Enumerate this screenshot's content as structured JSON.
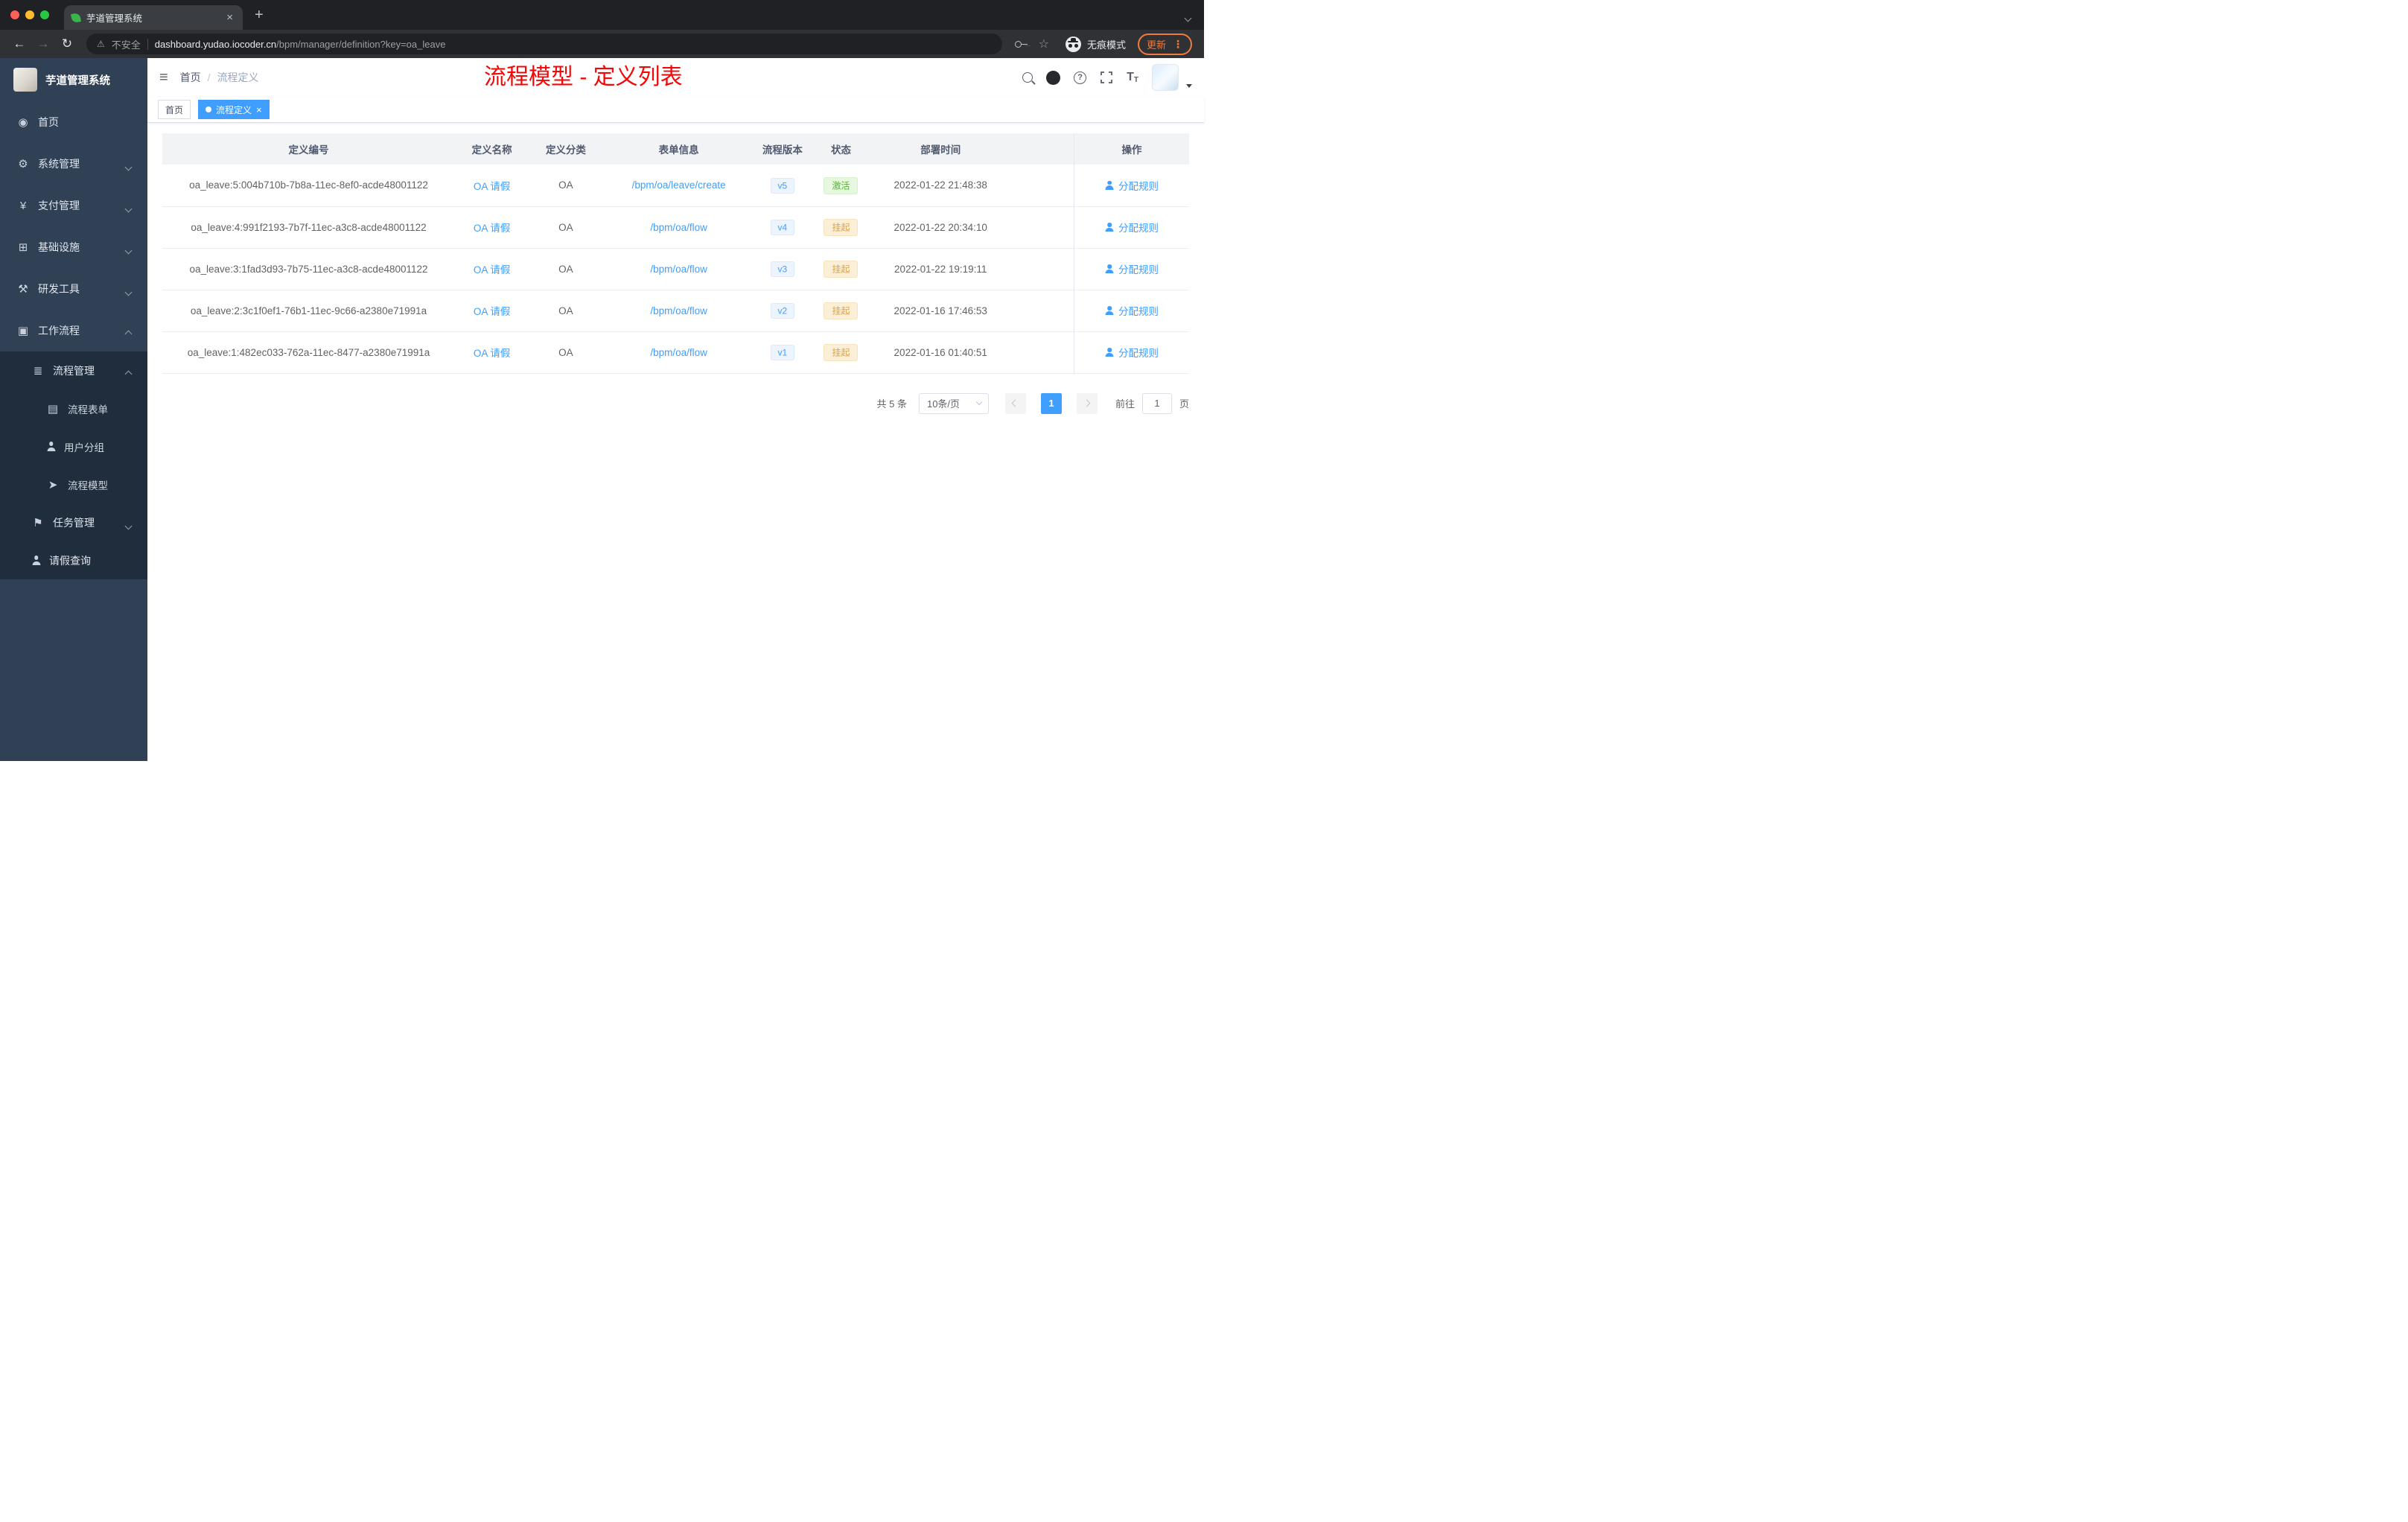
{
  "colors": {
    "accent": "#409eff",
    "success": "#52b62e",
    "warning": "#dba049",
    "annotation_red": "#f40606",
    "sidebar_bg": "#304156",
    "submenu_bg": "#1f2d3d"
  },
  "browser": {
    "tab_title": "芋道管理系统",
    "security_warning": "不安全",
    "url_host": "dashboard.yudao.iocoder.cn",
    "url_path": "/bpm/manager/definition?key=oa_leave",
    "incognito_label": "无痕模式",
    "update_label": "更新"
  },
  "sidebar": {
    "logo_title": "芋道管理系统",
    "top_items": [
      {
        "key": "home",
        "label": "首页",
        "icon": "dashboard",
        "icon_name": "dashboard-icon"
      },
      {
        "key": "system-management",
        "label": "系统管理",
        "icon": "gear",
        "icon_name": "gear-icon",
        "chevron": "down"
      },
      {
        "key": "payment-management",
        "label": "支付管理",
        "icon": "payment",
        "icon_name": "yen-icon",
        "chevron": "down"
      },
      {
        "key": "infrastructure",
        "label": "基础设施",
        "icon": "infra",
        "icon_name": "infrastructure-icon",
        "chevron": "down"
      },
      {
        "key": "dev-tools",
        "label": "研发工具",
        "icon": "tools",
        "icon_name": "tools-icon",
        "chevron": "down"
      },
      {
        "key": "workflow",
        "label": "工作流程",
        "icon": "briefcase",
        "icon_name": "briefcase-icon",
        "chevron": "up"
      }
    ],
    "workflow_children": [
      {
        "key": "process-management",
        "label": "流程管理",
        "icon": "list",
        "icon_name": "list-icon",
        "chevron": "up",
        "level": 2
      },
      {
        "key": "process-form",
        "label": "流程表单",
        "icon": "doc",
        "icon_name": "document-icon",
        "level": 3
      },
      {
        "key": "user-group",
        "label": "用户分组",
        "icon": "person",
        "icon_name": "users-icon",
        "level": 3
      },
      {
        "key": "process-model",
        "label": "流程模型",
        "icon": "plane",
        "icon_name": "paper-plane-icon",
        "level": 3
      },
      {
        "key": "task-management",
        "label": "任务管理",
        "icon": "flag",
        "icon_name": "tasks-icon",
        "chevron": "down",
        "level": 2
      },
      {
        "key": "leave-query",
        "label": "请假查询",
        "icon": "person",
        "icon_name": "user-icon",
        "level": 2
      }
    ]
  },
  "header": {
    "breadcrumb": [
      "首页",
      "流程定义"
    ],
    "annotation": "流程模型 - 定义列表"
  },
  "tags": [
    {
      "label": "首页",
      "active": false,
      "closable": false
    },
    {
      "label": "流程定义",
      "active": true,
      "closable": true
    }
  ],
  "table": {
    "columns": [
      "定义编号",
      "定义名称",
      "定义分类",
      "表单信息",
      "流程版本",
      "状态",
      "部署时间",
      "操作"
    ],
    "rows": [
      {
        "id": "oa_leave:5:004b710b-7b8a-11ec-8ef0-acde48001122",
        "name": "OA 请假",
        "category": "OA",
        "form": "/bpm/oa/leave/create",
        "version": "v5",
        "status": "激活",
        "status_type": "success",
        "deploy_time": "2022-01-22 21:48:38",
        "action": "分配规则"
      },
      {
        "id": "oa_leave:4:991f2193-7b7f-11ec-a3c8-acde48001122",
        "name": "OA 请假",
        "category": "OA",
        "form": "/bpm/oa/flow",
        "version": "v4",
        "status": "挂起",
        "status_type": "warning",
        "deploy_time": "2022-01-22 20:34:10",
        "action": "分配规则"
      },
      {
        "id": "oa_leave:3:1fad3d93-7b75-11ec-a3c8-acde48001122",
        "name": "OA 请假",
        "category": "OA",
        "form": "/bpm/oa/flow",
        "version": "v3",
        "status": "挂起",
        "status_type": "warning",
        "deploy_time": "2022-01-22 19:19:11",
        "action": "分配规则"
      },
      {
        "id": "oa_leave:2:3c1f0ef1-76b1-11ec-9c66-a2380e71991a",
        "name": "OA 请假",
        "category": "OA",
        "form": "/bpm/oa/flow",
        "version": "v2",
        "status": "挂起",
        "status_type": "warning",
        "deploy_time": "2022-01-16 17:46:53",
        "action": "分配规则"
      },
      {
        "id": "oa_leave:1:482ec033-762a-11ec-8477-a2380e71991a",
        "name": "OA 请假",
        "category": "OA",
        "form": "/bpm/oa/flow",
        "version": "v1",
        "status": "挂起",
        "status_type": "warning",
        "deploy_time": "2022-01-16 01:40:51",
        "action": "分配规则"
      }
    ]
  },
  "pagination": {
    "total": "共 5 条",
    "page_size": "10条/页",
    "current_page": "1",
    "goto_label": "前往",
    "goto_value": "1",
    "page_unit": "页"
  }
}
